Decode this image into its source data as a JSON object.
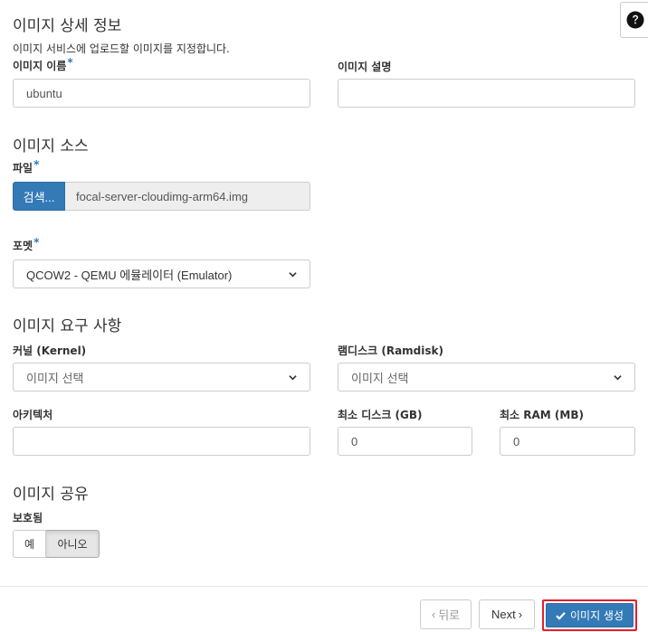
{
  "help": {
    "icon": "question-circle-icon"
  },
  "details": {
    "title": "이미지 상세 정보",
    "description": "이미지 서비스에 업로드할 이미지를 지정합니다.",
    "name_label": "이미지 이름",
    "name_value": "ubuntu",
    "desc_label": "이미지 설명",
    "desc_value": ""
  },
  "source": {
    "title": "이미지 소스",
    "file_label": "파일",
    "browse_label": "검색...",
    "file_name": "focal-server-cloudimg-arm64.img",
    "format_label": "포멧",
    "format_value": "QCOW2 - QEMU 에뮬레이터 (Emulator)"
  },
  "requirements": {
    "title": "이미지 요구 사항",
    "kernel_label": "커널 (Kernel)",
    "kernel_value": "이미지 선택",
    "ramdisk_label": "램디스크 (Ramdisk)",
    "ramdisk_value": "이미지 선택",
    "arch_label": "아키텍처",
    "arch_value": "",
    "min_disk_label": "최소 디스크 (GB)",
    "min_disk_value": "0",
    "min_ram_label": "최소 RAM (MB)",
    "min_ram_value": "0"
  },
  "sharing": {
    "title": "이미지 공유",
    "protected_label": "보호됨",
    "yes_label": "예",
    "no_label": "아니오"
  },
  "footer": {
    "back_label": "뒤로",
    "next_label": "Next",
    "create_label": "이미지 생성"
  },
  "colors": {
    "primary": "#337ab7",
    "required_mark": "#2a7ab8",
    "highlight_border": "#e0202a"
  }
}
